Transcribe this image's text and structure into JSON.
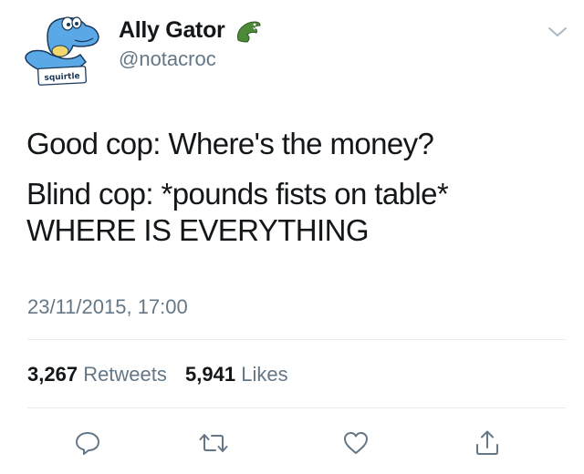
{
  "tweet": {
    "author": {
      "display_name": "Ally Gator",
      "handle": "@notacroc",
      "name_emoji": "crocodile-emoji",
      "avatar_label": "squirtle"
    },
    "text_lines": [
      "Good cop: Where's the money?",
      "Blind cop: *pounds fists on table*",
      "WHERE IS EVERYTHING"
    ],
    "timestamp": "23/11/2015, 17:00",
    "stats": {
      "retweets_count": "3,267",
      "retweets_label": "Retweets",
      "likes_count": "5,941",
      "likes_label": "Likes"
    },
    "actions": [
      "reply-icon",
      "retweet-icon",
      "like-icon",
      "share-icon"
    ]
  },
  "colors": {
    "text": "#14171a",
    "secondary": "#657786",
    "divider": "#e6ecf0"
  }
}
